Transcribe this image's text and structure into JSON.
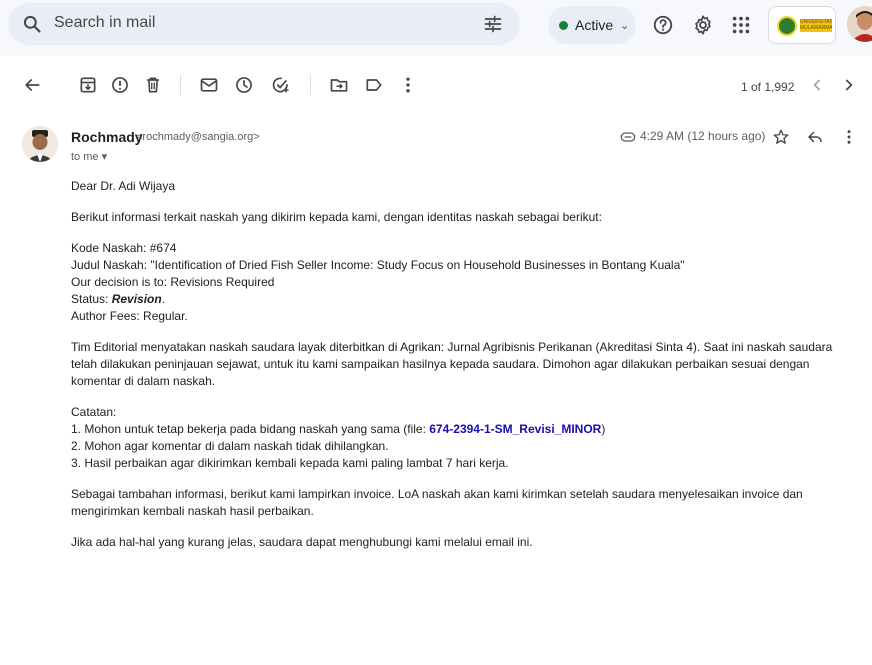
{
  "search": {
    "placeholder": "Search in mail"
  },
  "status": {
    "label": "Active"
  },
  "account": {
    "brand_text": "UNIVERSITAS MULAWARMAN"
  },
  "pager": {
    "text": "1 of 1,992"
  },
  "email": {
    "sender_name": "Rochmady",
    "sender_email": "<rochmady@sangia.org>",
    "to_label": "to me",
    "time": "4:29 AM (12 hours ago)",
    "greeting": "Dear Dr. Adi Wijaya",
    "intro": "Berikut informasi terkait naskah yang dikirim kepada kami, dengan identitas naskah sebagai berikut:",
    "kode": "Kode Naskah: #674",
    "judul": "Judul Naskah: \"Identification of Dried Fish Seller Income: Study Focus on Household Businesses in Bontang Kuala\"",
    "decision": "Our decision is to: Revisions Required",
    "status_prefix": "Status: ",
    "status_value": "Revision",
    "status_suffix": ".",
    "fees": "Author Fees: Regular.",
    "para1": "Tim Editorial menyatakan naskah saudara layak diterbitkan di Agrikan: Jurnal Agribisnis Perikanan (Akreditasi Sinta 4). Saat ini naskah saudara telah dilakukan peninjauan sejawat, untuk itu kami sampaikan hasilnya kepada saudara. Dimohon agar dilakukan perbaikan sesuai dengan komentar di dalam naskah.",
    "catatan_title": "Catatan:",
    "note1_prefix": "1. Mohon untuk tetap bekerja pada bidang naskah yang sama (file: ",
    "note1_link": "674-2394-1-SM_Revisi_MINOR",
    "note1_suffix": ")",
    "note2": "2. Mohon agar komentar di dalam naskah tidak dihilangkan.",
    "note3": "3. Hasil perbaikan agar dikirimkan kembali kepada kami paling lambat 7 hari kerja.",
    "para2": "Sebagai tambahan informasi, berikut kami lampirkan invoice. LoA naskah akan kami kirimkan setelah saudara menyelesaikan invoice dan mengirimkan kembali naskah hasil perbaikan.",
    "para3": "Jika ada hal-hal yang kurang jelas, saudara dapat menghubungi kami melalui email ini."
  },
  "colors": {
    "active_dot": "#188038",
    "link": "#1a0dab",
    "topbar_bg": "#f6f8fc"
  }
}
